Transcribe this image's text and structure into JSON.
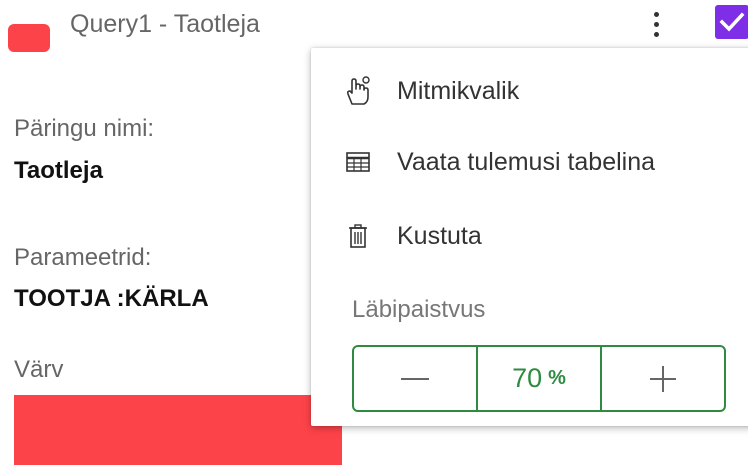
{
  "header": {
    "title": "Query1 - Taotleja",
    "swatch_color": "#fc4349",
    "checkbox_color": "#7d2ee6",
    "checked": true
  },
  "details": {
    "name_label": "Päringu nimi:",
    "name_value": "Taotleja",
    "params_label": "Parameetrid:",
    "params_value": "TOOTJA :KÄRLA",
    "color_label": "Värv",
    "color_value": "#fc4349"
  },
  "menu": {
    "items": [
      {
        "label": "Mitmikvalik",
        "icon": "hand-pointer-icon"
      },
      {
        "label": "Vaata tulemusi tabelina",
        "icon": "table-icon"
      },
      {
        "label": "Kustuta",
        "icon": "trash-icon"
      }
    ],
    "opacity": {
      "label": "Läbipaistvus",
      "value": "70",
      "unit": "%",
      "decrement_icon": "minus-icon",
      "increment_icon": "plus-icon",
      "accent_color": "#2e8b40"
    }
  }
}
